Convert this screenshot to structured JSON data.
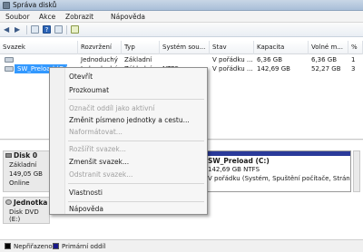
{
  "window": {
    "title": "Správa disků"
  },
  "menu": [
    "Soubor",
    "Akce",
    "Zobrazit",
    "Nápověda"
  ],
  "volumes": {
    "headers": [
      "Svazek",
      "Rozvržení",
      "Typ",
      "Systém sou...",
      "Stav",
      "Kapacita",
      "Volné m...",
      "%"
    ],
    "rows": [
      {
        "name": "",
        "layout": "Jednoduchý",
        "type": "Základní",
        "fs": "",
        "status": "V pořádku ...",
        "capacity": "6,36 GB",
        "free": "6,36 GB",
        "pct": "1"
      },
      {
        "name": "SW_Preload (C:)",
        "layout": "Jednoduchý",
        "type": "Základní",
        "fs": "NTFS",
        "status": "V pořádku ...",
        "capacity": "142,69 GB",
        "free": "52,27 GB",
        "pct": "3"
      }
    ]
  },
  "disks": {
    "disk0": {
      "name": "Disk 0",
      "type": "Základní",
      "size": "149,05 GB",
      "status": "Online"
    },
    "partition": {
      "name": "SW_Preload  (C:)",
      "size": "142,69 GB NTFS",
      "status": "V pořádku (Systém, Spuštění počítače, Stránk"
    },
    "cdrom": {
      "name": "Jednotka",
      "type": "Disk DVD (E:)"
    }
  },
  "legend": {
    "unallocated": "Nepřiřazeno",
    "primary": "Primární oddíl",
    "unallocated_color": "#000000",
    "primary_color": "#1a1a8a"
  },
  "context_menu": {
    "items": [
      {
        "label": "Otevřít",
        "enabled": true
      },
      {
        "label": "Prozkoumat",
        "enabled": true
      },
      {
        "label": "Označit oddíl jako aktivní",
        "enabled": false
      },
      {
        "label": "Změnit písmeno jednotky a cestu...",
        "enabled": true
      },
      {
        "label": "Naformátovat...",
        "enabled": false
      },
      {
        "label": "Rozšířit svazek...",
        "enabled": false
      },
      {
        "label": "Zmenšit svazek...",
        "enabled": true
      },
      {
        "label": "Odstranit svazek...",
        "enabled": false
      },
      {
        "label": "Vlastnosti",
        "enabled": true
      },
      {
        "label": "Nápověda",
        "enabled": true
      }
    ]
  }
}
